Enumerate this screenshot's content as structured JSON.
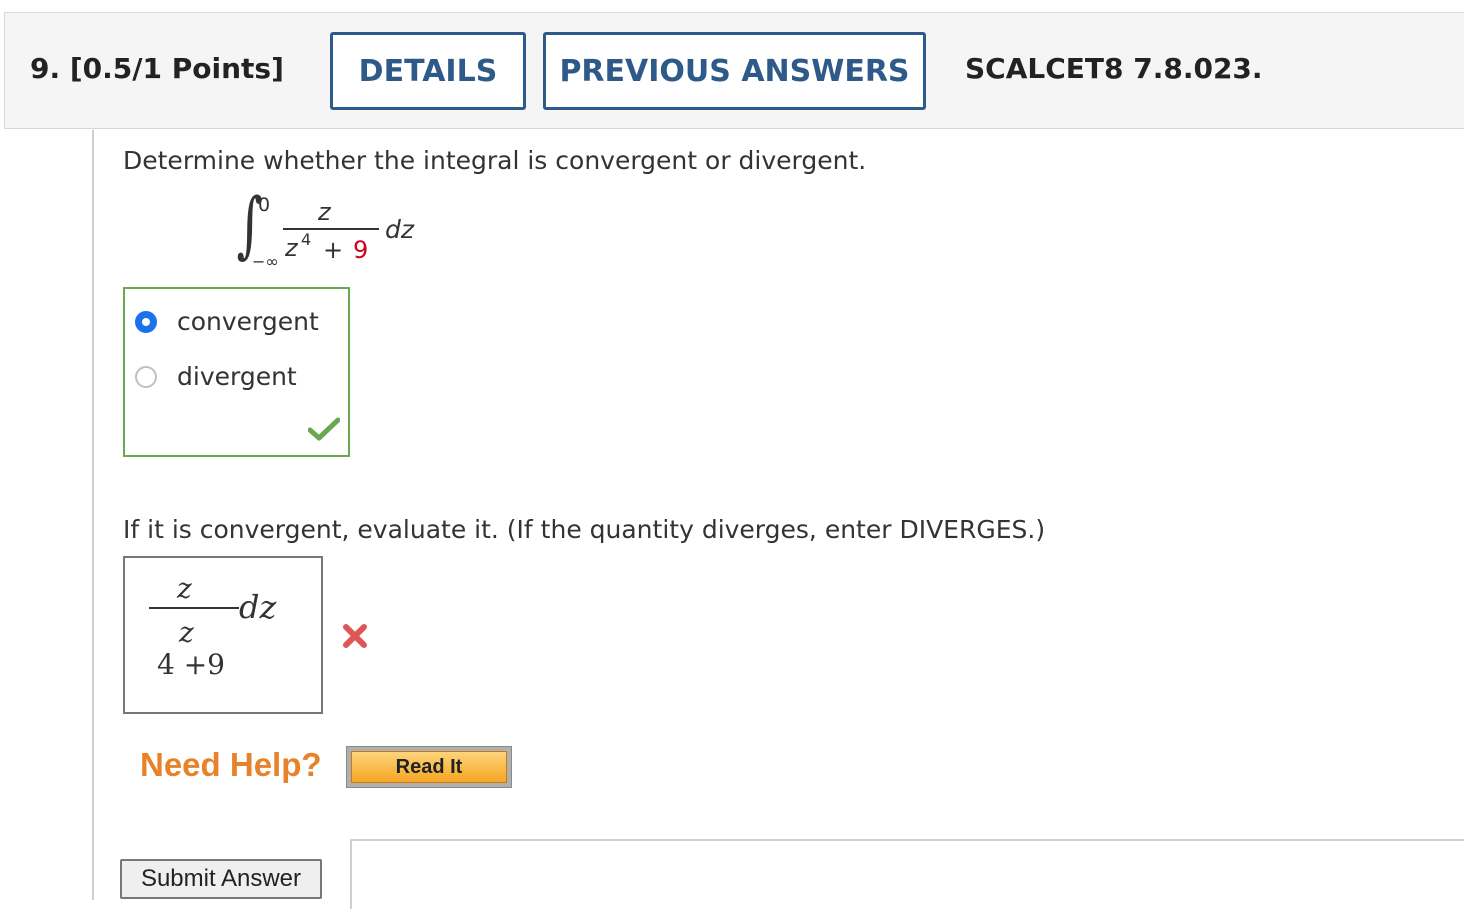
{
  "header": {
    "question_number": "9.",
    "points": "[0.5/1 Points]",
    "details_label": "DETAILS",
    "previous_answers_label": "PREVIOUS ANSWERS",
    "question_code": "SCALCET8 7.8.023."
  },
  "part1": {
    "prompt": "Determine whether the integral is convergent or divergent.",
    "integral": {
      "upper_limit": "0",
      "lower_limit": "−∞",
      "numerator": "z",
      "denominator_base": "z",
      "denominator_exponent": "4",
      "denominator_plus": "+",
      "denominator_constant": "9",
      "differential": "dz"
    },
    "options": [
      {
        "label": "convergent",
        "selected": true
      },
      {
        "label": "divergent",
        "selected": false
      }
    ],
    "result_icon": "check-icon"
  },
  "part2": {
    "prompt": "If it is convergent, evaluate it. (If the quantity diverges, enter DIVERGES.)",
    "answer": {
      "numerator": "z",
      "differential": "dz",
      "denominator_var": "z",
      "denominator_expr": "4 +9"
    },
    "result_icon": "x-icon"
  },
  "help": {
    "need_help_label": "Need Help?",
    "read_it_label": "Read It"
  },
  "submit_label": "Submit Answer",
  "colors": {
    "accent": "#2d5a89",
    "correct": "#6aa84f",
    "incorrect": "#e05555",
    "help": "#e8822a",
    "highlight_constant": "#d0021b"
  }
}
